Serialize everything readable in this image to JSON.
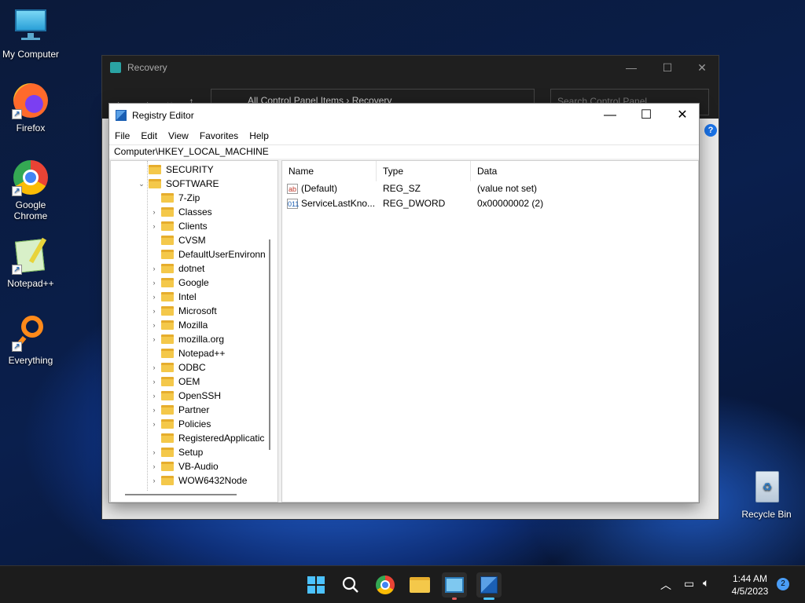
{
  "desktop": {
    "icons": [
      {
        "label": "My Computer"
      },
      {
        "label": "Firefox"
      },
      {
        "label": "Google Chrome"
      },
      {
        "label": "Notepad++"
      },
      {
        "label": "Everything"
      },
      {
        "label": "Recycle Bin"
      }
    ]
  },
  "recovery": {
    "title": "Recovery",
    "address": "All Control Panel Items  ›  Recovery",
    "search_placeholder": "Search Control Panel",
    "help": "?"
  },
  "regedit": {
    "title": "Registry Editor",
    "menu": [
      "File",
      "Edit",
      "View",
      "Favorites",
      "Help"
    ],
    "path": "Computer\\HKEY_LOCAL_MACHINE",
    "tree": [
      {
        "label": "SECURITY",
        "level": 1,
        "chevron": ""
      },
      {
        "label": "SOFTWARE",
        "level": 1,
        "chevron": "⌄"
      },
      {
        "label": "7-Zip",
        "level": 2,
        "chevron": ""
      },
      {
        "label": "Classes",
        "level": 2,
        "chevron": "›"
      },
      {
        "label": "Clients",
        "level": 2,
        "chevron": "›"
      },
      {
        "label": "CVSM",
        "level": 2,
        "chevron": ""
      },
      {
        "label": "DefaultUserEnvironn",
        "level": 2,
        "chevron": ""
      },
      {
        "label": "dotnet",
        "level": 2,
        "chevron": "›"
      },
      {
        "label": "Google",
        "level": 2,
        "chevron": "›"
      },
      {
        "label": "Intel",
        "level": 2,
        "chevron": "›"
      },
      {
        "label": "Microsoft",
        "level": 2,
        "chevron": "›"
      },
      {
        "label": "Mozilla",
        "level": 2,
        "chevron": "›"
      },
      {
        "label": "mozilla.org",
        "level": 2,
        "chevron": "›"
      },
      {
        "label": "Notepad++",
        "level": 2,
        "chevron": ""
      },
      {
        "label": "ODBC",
        "level": 2,
        "chevron": "›"
      },
      {
        "label": "OEM",
        "level": 2,
        "chevron": "›"
      },
      {
        "label": "OpenSSH",
        "level": 2,
        "chevron": "›"
      },
      {
        "label": "Partner",
        "level": 2,
        "chevron": "›"
      },
      {
        "label": "Policies",
        "level": 2,
        "chevron": "›"
      },
      {
        "label": "RegisteredApplicatic",
        "level": 2,
        "chevron": ""
      },
      {
        "label": "Setup",
        "level": 2,
        "chevron": "›"
      },
      {
        "label": "VB-Audio",
        "level": 2,
        "chevron": "›"
      },
      {
        "label": "WOW6432Node",
        "level": 2,
        "chevron": "›"
      }
    ],
    "columns": [
      "Name",
      "Type",
      "Data"
    ],
    "values": [
      {
        "icon": "ab",
        "name": "(Default)",
        "type": "REG_SZ",
        "data": "(value not set)"
      },
      {
        "icon": "011",
        "name": "ServiceLastKno...",
        "type": "REG_DWORD",
        "data": "0x00000002 (2)"
      }
    ]
  },
  "taskbar": {
    "time": "1:44 AM",
    "date": "4/5/2023",
    "notifications": "2",
    "apps": [
      "start-icon",
      "search-icon",
      "chrome-icon",
      "file-explorer-icon",
      "control-panel-icon",
      "registry-editor-icon"
    ]
  }
}
